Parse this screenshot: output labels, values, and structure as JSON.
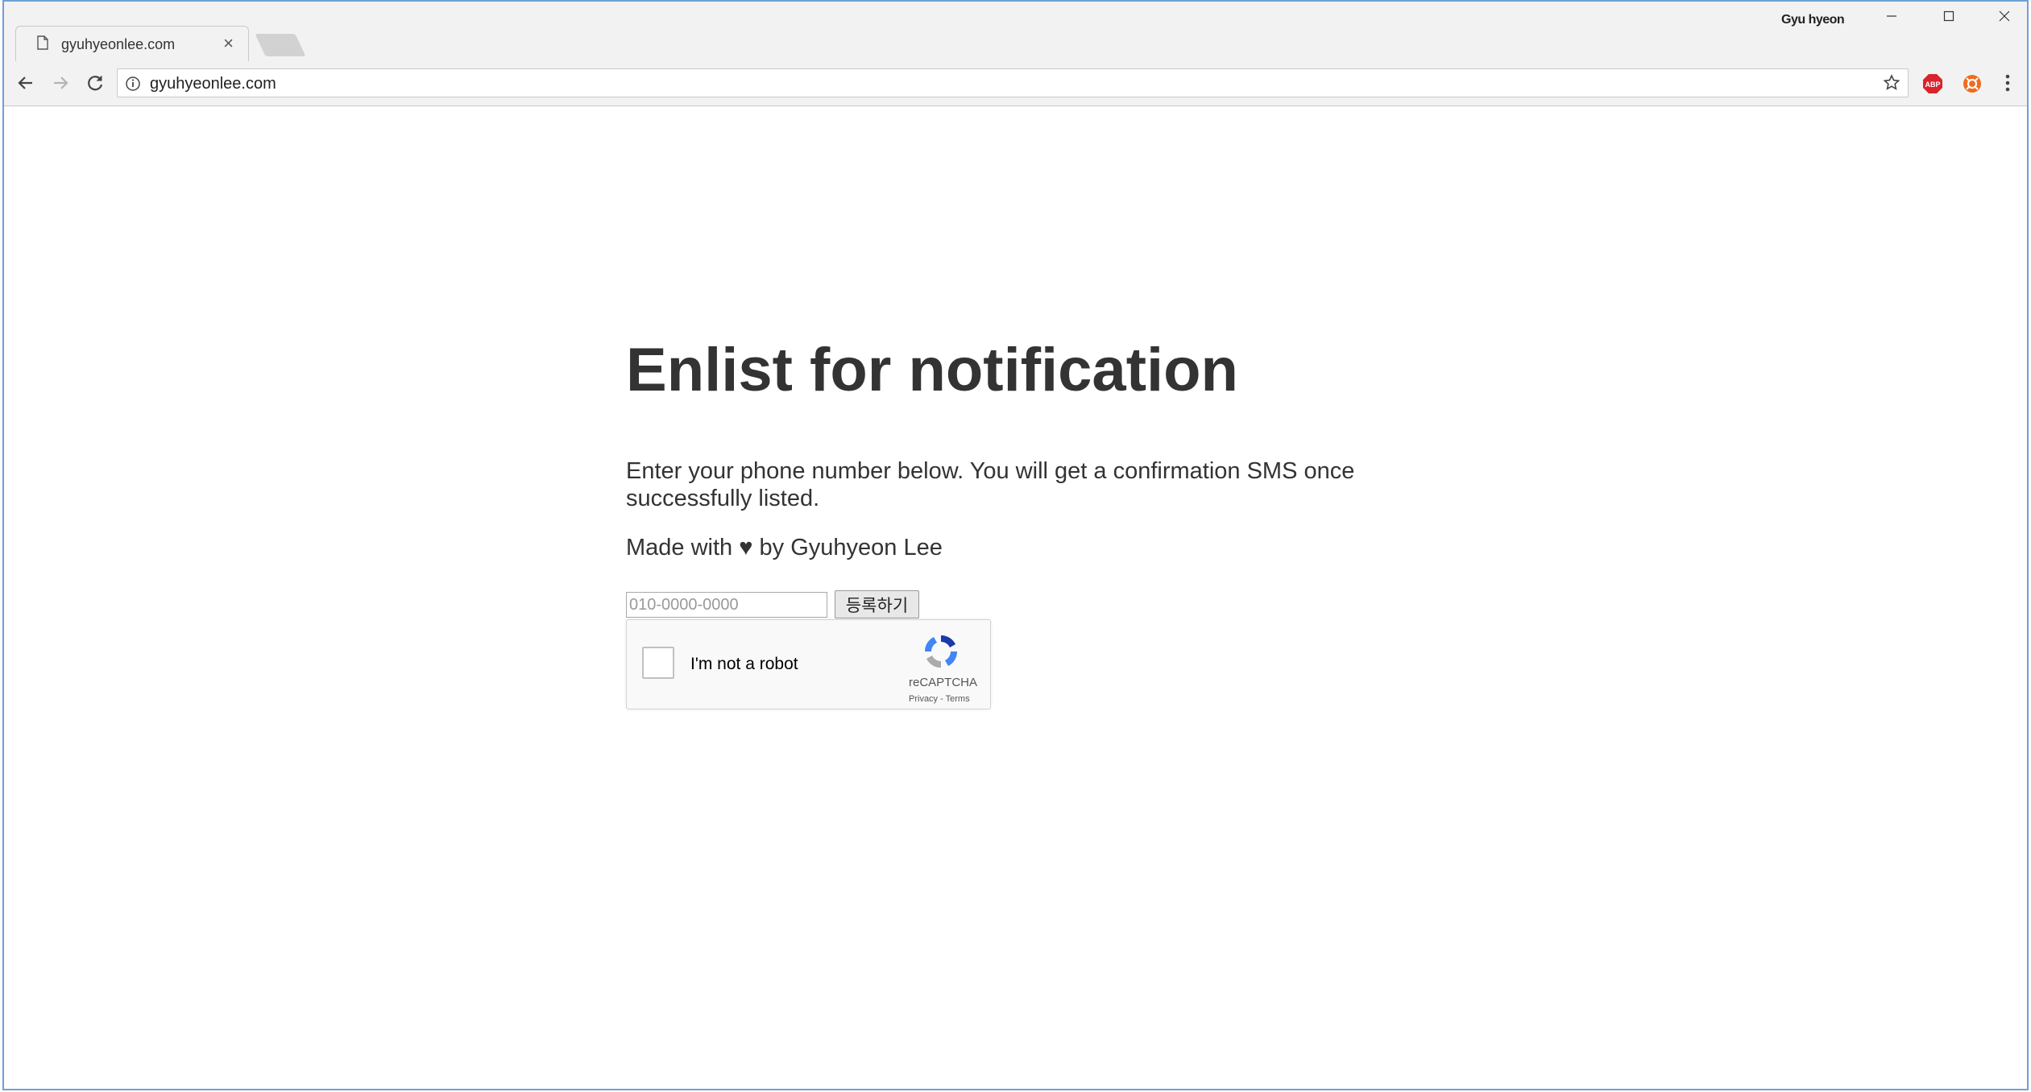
{
  "browser": {
    "tab_title": "gyuhyeonlee.com",
    "tab_close": "×",
    "profile_name": "Gyu hyeon",
    "url": "gyuhyeonlee.com",
    "extensions": [
      {
        "name": "adblock-plus",
        "label": "ABP",
        "color": "#d9232d"
      },
      {
        "name": "orange-extension",
        "color": "#f06b1d"
      }
    ]
  },
  "page": {
    "heading": "Enlist for notification",
    "description": "Enter your phone number below. You will get a confirmation SMS once successfully listed.",
    "credit": "Made with ♥ by Gyuhyeon Lee",
    "phone_placeholder": "010-0000-0000",
    "submit_label": "등록하기",
    "recaptcha": {
      "checkbox_label": "I'm not a robot",
      "brand": "reCAPTCHA",
      "links": "Privacy - Terms"
    }
  }
}
